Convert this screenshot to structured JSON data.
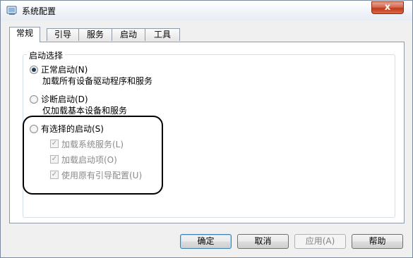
{
  "window": {
    "title": "系统配置",
    "close_label": "x",
    "app_icon": "system-config-icon"
  },
  "tabs": [
    {
      "label": "常规",
      "active": true
    },
    {
      "label": "引导",
      "active": false
    },
    {
      "label": "服务",
      "active": false
    },
    {
      "label": "启动",
      "active": false
    },
    {
      "label": "工具",
      "active": false
    }
  ],
  "startup_group": {
    "title": "启动选择",
    "normal": {
      "label": "正常启动(N)",
      "description": "加载所有设备驱动程序和服务",
      "selected": true
    },
    "diagnostic": {
      "label": "诊断启动(D)",
      "description": "仅加载基本设备和服务",
      "selected": false
    },
    "selective": {
      "label": "有选择的启动(S)",
      "selected": false,
      "options": [
        {
          "label": "加载系统服务(L)",
          "checked": true,
          "enabled": false
        },
        {
          "label": "加载启动项(O)",
          "checked": true,
          "enabled": false
        },
        {
          "label": "使用原有引导配置(U)",
          "checked": true,
          "enabled": false
        }
      ]
    }
  },
  "buttons": {
    "ok": "确定",
    "cancel": "取消",
    "apply": "应用(A)",
    "help": "帮助"
  },
  "colors": {
    "highlight_outline": "#000000",
    "close_button": "#c2391b"
  }
}
